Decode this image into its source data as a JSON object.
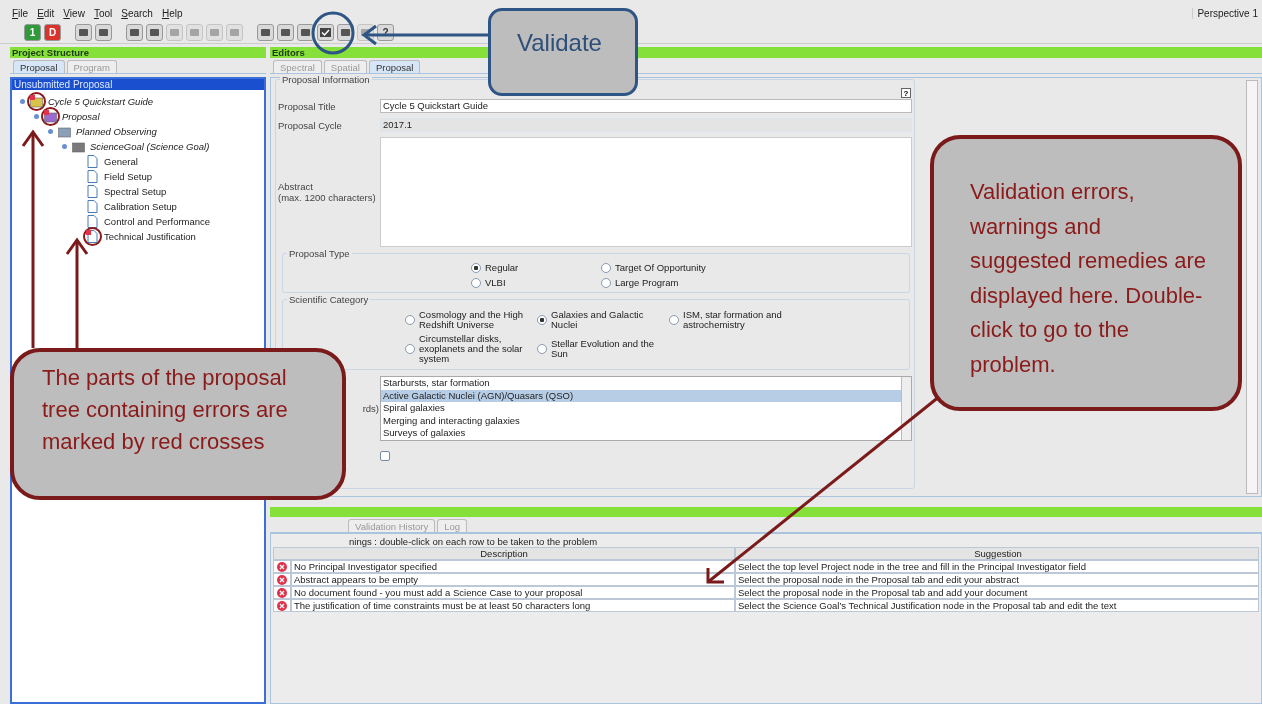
{
  "menu": [
    "File",
    "Edit",
    "View",
    "Tool",
    "Search",
    "Help"
  ],
  "perspective": "Perspective 1",
  "toolbar": [
    {
      "label": "1",
      "kind": "green",
      "disabled": false
    },
    {
      "label": "D",
      "kind": "red",
      "disabled": false
    },
    {
      "kind": "plain",
      "disabled": false
    },
    {
      "kind": "plain",
      "disabled": false
    },
    {
      "kind": "plain",
      "disabled": false
    },
    {
      "kind": "plain",
      "disabled": false
    },
    {
      "kind": "plain",
      "disabled": true
    },
    {
      "kind": "plain",
      "disabled": true
    },
    {
      "kind": "plain",
      "disabled": true
    },
    {
      "kind": "plain",
      "disabled": true
    },
    {
      "kind": "plain",
      "disabled": false
    },
    {
      "kind": "plain",
      "disabled": false
    },
    {
      "kind": "plain",
      "disabled": false
    },
    {
      "kind": "check",
      "disabled": false
    },
    {
      "kind": "plain",
      "disabled": false
    },
    {
      "kind": "plain",
      "disabled": true
    },
    {
      "label": "?",
      "kind": "plain",
      "disabled": false
    }
  ],
  "project_structure": {
    "title": "Project Structure",
    "tabs": [
      {
        "label": "Proposal",
        "selected": true
      },
      {
        "label": "Program",
        "selected": false
      }
    ],
    "tree": {
      "root": "Unsubmitted Proposal",
      "root_selected": true,
      "items": [
        {
          "label": "Cycle 5 Quickstart Guide",
          "kind": "folder",
          "error": true,
          "children": [
            {
              "label": "Proposal",
              "kind": "proposal",
              "error": true,
              "children": [
                {
                  "label": "Planned Observing",
                  "kind": "observing",
                  "error": false,
                  "children": [
                    {
                      "label": "ScienceGoal (Science Goal)",
                      "kind": "goal",
                      "error": false,
                      "children": [
                        {
                          "label": "General",
                          "kind": "page",
                          "error": false
                        },
                        {
                          "label": "Field Setup",
                          "kind": "page",
                          "error": false
                        },
                        {
                          "label": "Spectral Setup",
                          "kind": "page",
                          "error": false
                        },
                        {
                          "label": "Calibration Setup",
                          "kind": "page",
                          "error": false
                        },
                        {
                          "label": "Control and Performance",
                          "kind": "page",
                          "error": false
                        },
                        {
                          "label": "Technical Justification",
                          "kind": "page",
                          "error": true
                        }
                      ]
                    }
                  ]
                }
              ]
            }
          ]
        }
      ]
    }
  },
  "editors": {
    "title": "Editors",
    "tabs": [
      {
        "label": "Spectral",
        "selected": false
      },
      {
        "label": "Spatial",
        "selected": false
      },
      {
        "label": "Proposal",
        "selected": true
      }
    ],
    "section": "Proposal Information",
    "help": "?",
    "fields": [
      {
        "label": "Proposal Title",
        "value": "Cycle 5 Quickstart Guide",
        "editable": true
      },
      {
        "label": "Proposal Cycle",
        "value": "2017.1",
        "editable": false
      }
    ],
    "abstract_label": "Abstract",
    "abstract_hint": "(max. 1200 characters)",
    "proposal_type": {
      "title": "Proposal Type",
      "options": [
        {
          "label": "Regular",
          "selected": true
        },
        {
          "label": "Target Of Opportunity",
          "selected": false
        },
        {
          "label": "VLBI",
          "selected": false
        },
        {
          "label": "Large Program",
          "selected": false
        }
      ]
    },
    "scientific_category": {
      "title": "Scientific Category",
      "options": [
        {
          "label": "Cosmology and the High Redshift Universe",
          "selected": false
        },
        {
          "label": "Galaxies and Galactic Nuclei",
          "selected": true
        },
        {
          "label": "ISM, star formation and astrochemistry",
          "selected": false
        },
        {
          "label": "Circumstellar disks, exoplanets and the solar system",
          "selected": false
        },
        {
          "label": "Stellar Evolution and the Sun",
          "selected": false
        }
      ]
    },
    "keywords_label": "rds)",
    "keywords": [
      {
        "label": "Starbursts, star formation",
        "selected": false
      },
      {
        "label": "Active Galactic Nuclei (AGN)/Quasars (QSO)",
        "selected": true
      },
      {
        "label": "Spiral galaxies",
        "selected": false
      },
      {
        "label": "Merging and interacting galaxies",
        "selected": false
      },
      {
        "label": "Surveys of galaxies",
        "selected": false
      }
    ],
    "checkbox": {
      "checked": false
    }
  },
  "validation": {
    "tabs": [
      {
        "label": "Validation History",
        "selected": false
      },
      {
        "label": "Log",
        "selected": false
      }
    ],
    "hint": "nings : double-click on each row to be taken to the problem",
    "columns": [
      "Description",
      "Suggestion"
    ],
    "rows": [
      {
        "description": "No Principal Investigator specified",
        "suggestion": "Select the top level Project node in the tree and fill in the Principal Investigator field"
      },
      {
        "description": "Abstract appears to be empty",
        "suggestion": "Select the proposal node in the Proposal tab and edit your abstract"
      },
      {
        "description": "No document found - you must add a Science Case to your proposal",
        "suggestion": "Select the proposal node in the Proposal tab and add your document"
      },
      {
        "description": "The justification of time constraints must be at least 50 characters long",
        "suggestion": "Select the Science Goal’s Technical Justification node in the Proposal tab and edit the text"
      }
    ]
  },
  "callouts": [
    {
      "kind": "blue",
      "text": "Validate"
    },
    {
      "kind": "red",
      "text": "Validation errors, warnings and suggested remedies are displayed here. Double-click to go to the problem."
    },
    {
      "kind": "red",
      "text": "The parts of the proposal tree containing errors are marked by red crosses"
    }
  ]
}
